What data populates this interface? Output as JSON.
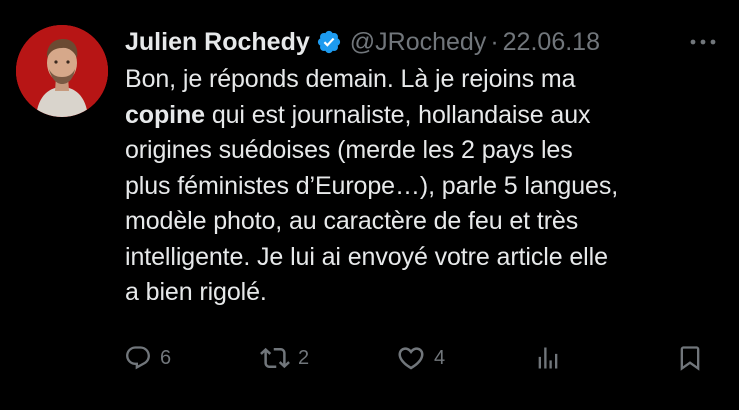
{
  "tweet": {
    "author": {
      "display_name": "Julien Rochedy",
      "handle": "@JRochedy",
      "verified": true,
      "avatar_ring_color": "#c41818"
    },
    "separator": "·",
    "date": "22.06.18",
    "more_icon": "more-horizontal-icon",
    "text_lines": [
      "Bon, je réponds demain. Là je rejoins ma",
      {
        "bold": "copine",
        "rest": " qui est journaliste, hollandaise aux"
      },
      "origines suédoises (merde les 2 pays les",
      "plus féministes d’Europe…), parle 5 langues,",
      "modèle photo, au caractère de feu et très",
      "intelligente. Je lui ai envoyé votre article elle",
      "a bien rigolé."
    ],
    "actions": {
      "replies": "6",
      "retweets": "2",
      "likes": "4",
      "views_icon": "analytics-icon",
      "bookmark_icon": "bookmark-icon"
    }
  },
  "colors": {
    "background": "#000000",
    "text_primary": "#e7e9ea",
    "text_secondary": "#71767b",
    "verified_blue": "#1d9bf0"
  }
}
